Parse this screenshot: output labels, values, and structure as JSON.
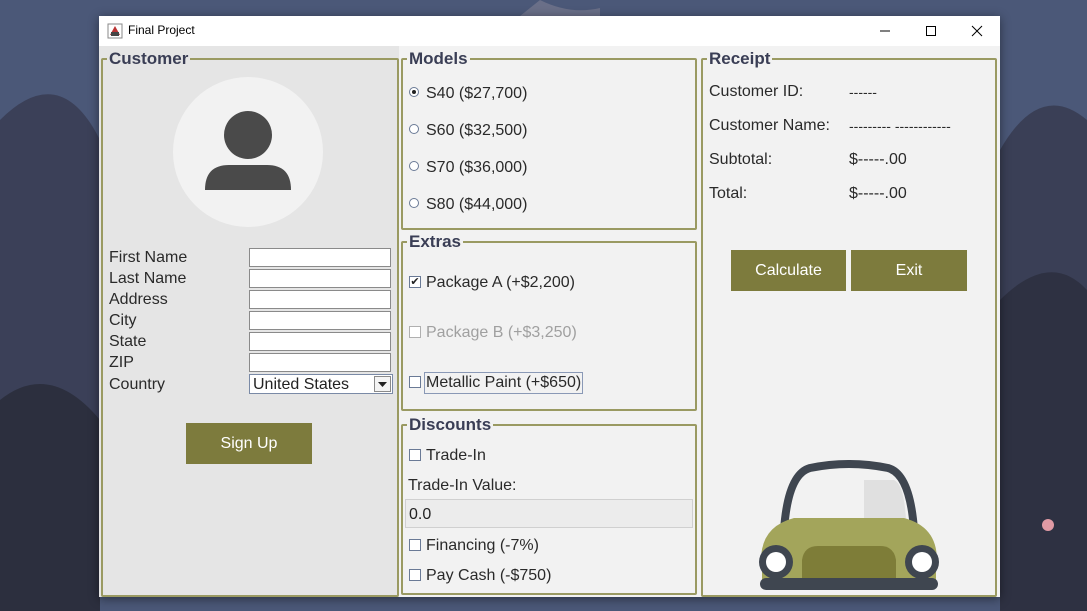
{
  "window": {
    "title": "Final Project"
  },
  "customer": {
    "heading": "Customer",
    "fields": [
      {
        "label": "First Name",
        "value": ""
      },
      {
        "label": "Last Name",
        "value": ""
      },
      {
        "label": "Address",
        "value": ""
      },
      {
        "label": "City",
        "value": ""
      },
      {
        "label": "State",
        "value": ""
      },
      {
        "label": "ZIP",
        "value": ""
      }
    ],
    "country_label": "Country",
    "country_value": "United States",
    "signup_label": "Sign Up"
  },
  "models": {
    "heading": "Models",
    "options": [
      {
        "label": "S40  ($27,700)",
        "selected": true
      },
      {
        "label": "S60  ($32,500)",
        "selected": false
      },
      {
        "label": "S70  ($36,000)",
        "selected": false
      },
      {
        "label": "S80  ($44,000)",
        "selected": false
      }
    ]
  },
  "extras": {
    "heading": "Extras",
    "options": [
      {
        "label": "Package A  (+$2,200)",
        "checked": true,
        "enabled": true
      },
      {
        "label": "Package B  (+$3,250)",
        "checked": false,
        "enabled": false
      },
      {
        "label": "Metallic Paint  (+$650)",
        "checked": false,
        "enabled": true
      }
    ]
  },
  "discounts": {
    "heading": "Discounts",
    "trade_in_label": "Trade-In",
    "trade_in_value_label": "Trade-In Value:",
    "trade_in_value": "0.0",
    "financing_label": "Financing  (-7%)",
    "pay_cash_label": "Pay Cash  (-$750)"
  },
  "receipt": {
    "heading": "Receipt",
    "rows": [
      {
        "label": "Customer ID:",
        "value": "------"
      },
      {
        "label": "Customer Name:",
        "value": "---------  ------------"
      },
      {
        "label": "Subtotal:",
        "value": "$-----.00"
      },
      {
        "label": "Total:",
        "value": "$-----.00"
      }
    ],
    "calculate_label": "Calculate",
    "exit_label": "Exit"
  },
  "colors": {
    "accent": "#7d7b3d",
    "group_border": "#9a9a62",
    "heading_text": "#3a3e55"
  }
}
